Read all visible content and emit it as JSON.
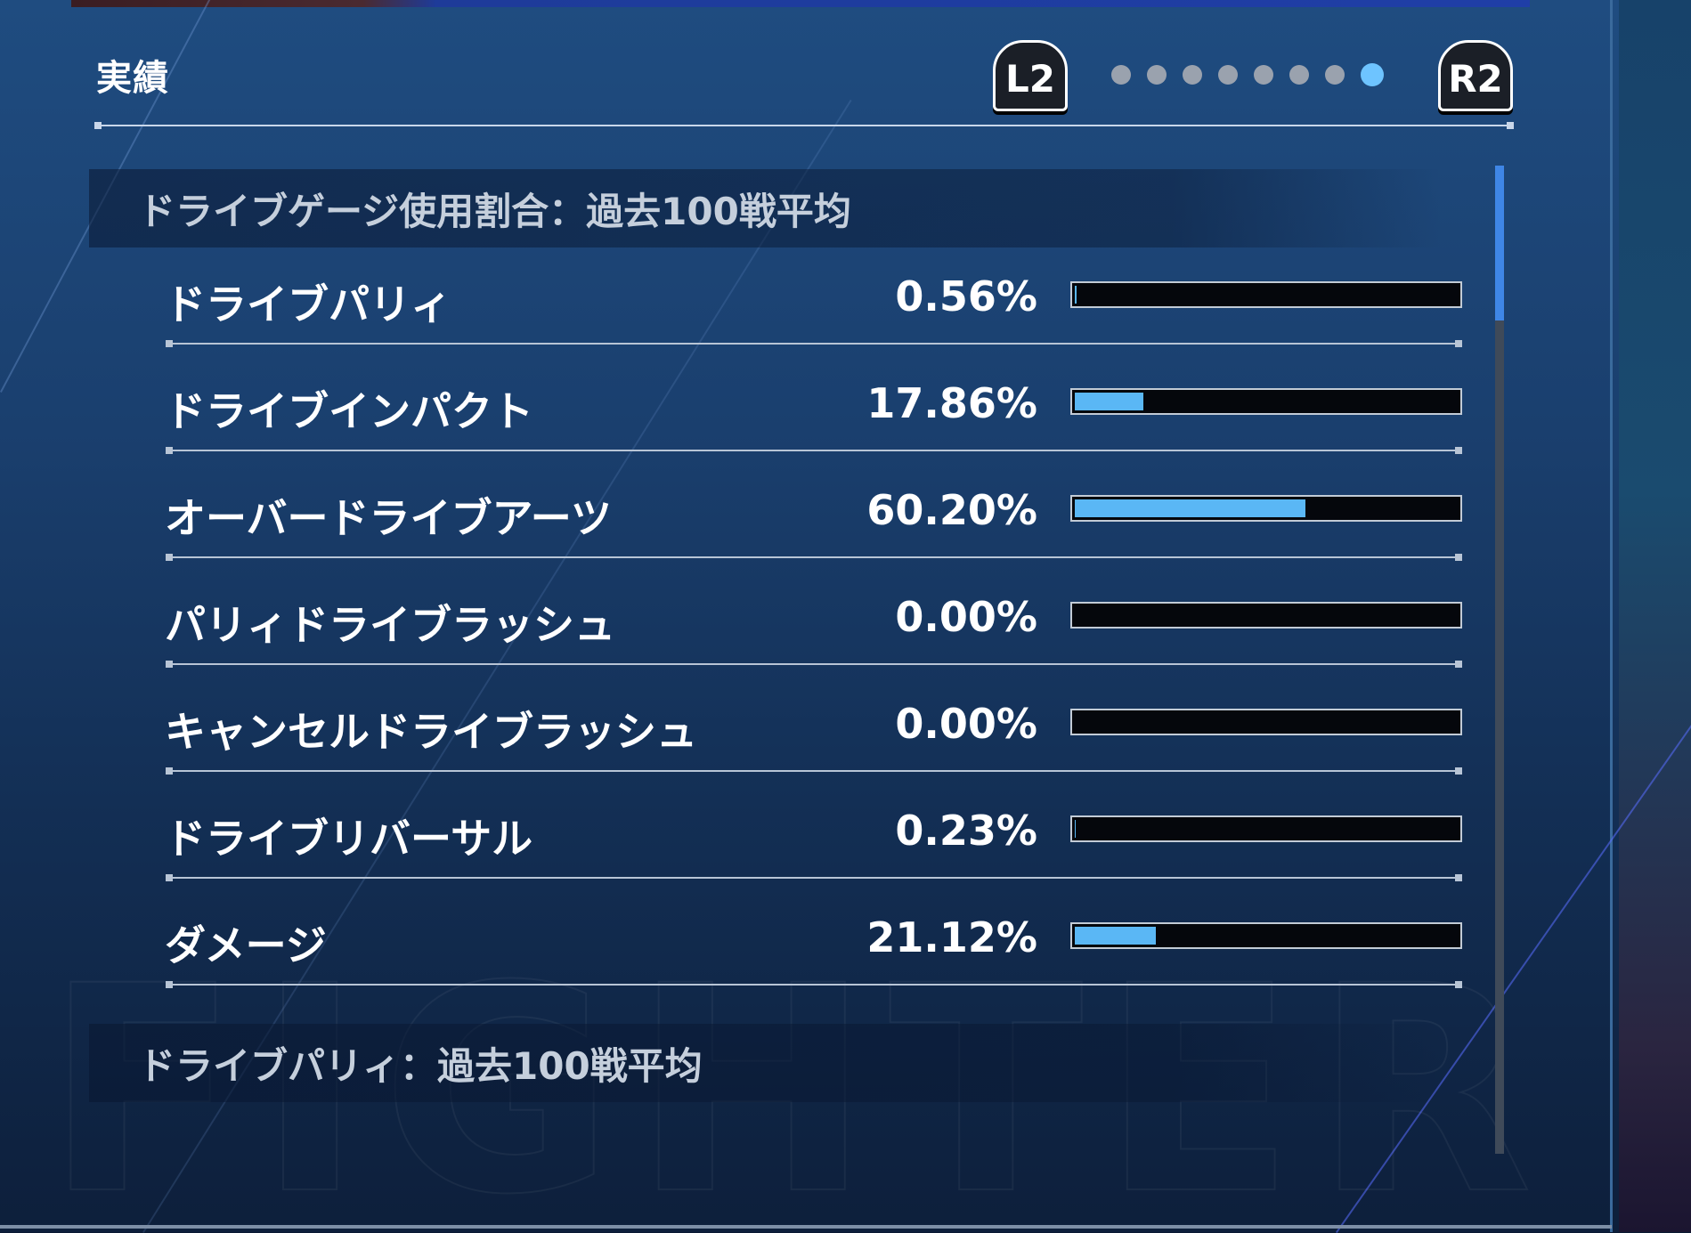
{
  "header": {
    "title": "実績",
    "l2_label": "L2",
    "r2_label": "R2",
    "page_count": 8,
    "active_page": 8
  },
  "section_usage": {
    "title": "ドライブゲージ使用割合：過去100戦平均",
    "rows": [
      {
        "label": "ドライブパリィ",
        "percent": "0.56%",
        "value": 0.56
      },
      {
        "label": "ドライブインパクト",
        "percent": "17.86%",
        "value": 17.86
      },
      {
        "label": "オーバードライブアーツ",
        "percent": "60.20%",
        "value": 60.2
      },
      {
        "label": "パリィドライブラッシュ",
        "percent": "0.00%",
        "value": 0.0
      },
      {
        "label": "キャンセルドライブラッシュ",
        "percent": "0.00%",
        "value": 0.0
      },
      {
        "label": "ドライブリバーサル",
        "percent": "0.23%",
        "value": 0.23
      },
      {
        "label": "ダメージ",
        "percent": "21.12%",
        "value": 21.12
      }
    ]
  },
  "section_parry": {
    "title": "ドライブパリィ：過去100戦平均"
  },
  "colors": {
    "bar_fill": "#5ab7f5",
    "active_dot": "#6ec4ff",
    "inactive_dot": "#9aa2ae",
    "scroll_thumb": "#3f86e6"
  }
}
